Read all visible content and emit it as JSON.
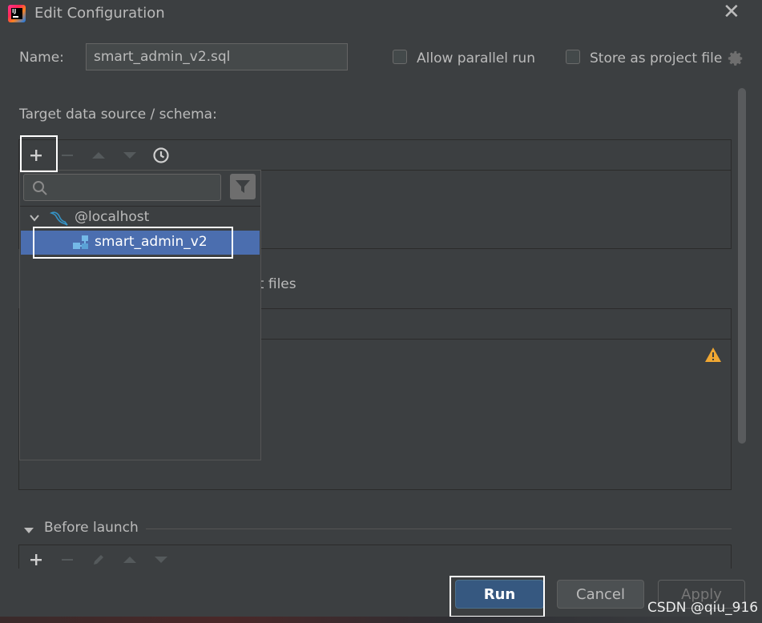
{
  "window": {
    "title": "Edit Configuration",
    "app_icon_text": "IJ"
  },
  "form": {
    "name_label": "Name:",
    "name_value": "smart_admin_v2.sql",
    "allow_parallel_label": "Allow parallel run",
    "store_project_label": "Store as project file"
  },
  "target": {
    "label": "Target data source / schema:"
  },
  "popup": {
    "search_placeholder": "",
    "tree": {
      "host_label": "@localhost",
      "schema_label": "smart_admin_v2"
    }
  },
  "scripts": {
    "label_partial": "pt files"
  },
  "before_launch": {
    "label": "Before launch"
  },
  "buttons": {
    "run": "Run",
    "cancel": "Cancel",
    "apply": "Apply"
  },
  "watermark": "CSDN @qiu_916",
  "colors": {
    "background": "#3c3f41",
    "selection": "#4b6eaf",
    "run_button": "#365880",
    "warning": "#f0a732"
  }
}
